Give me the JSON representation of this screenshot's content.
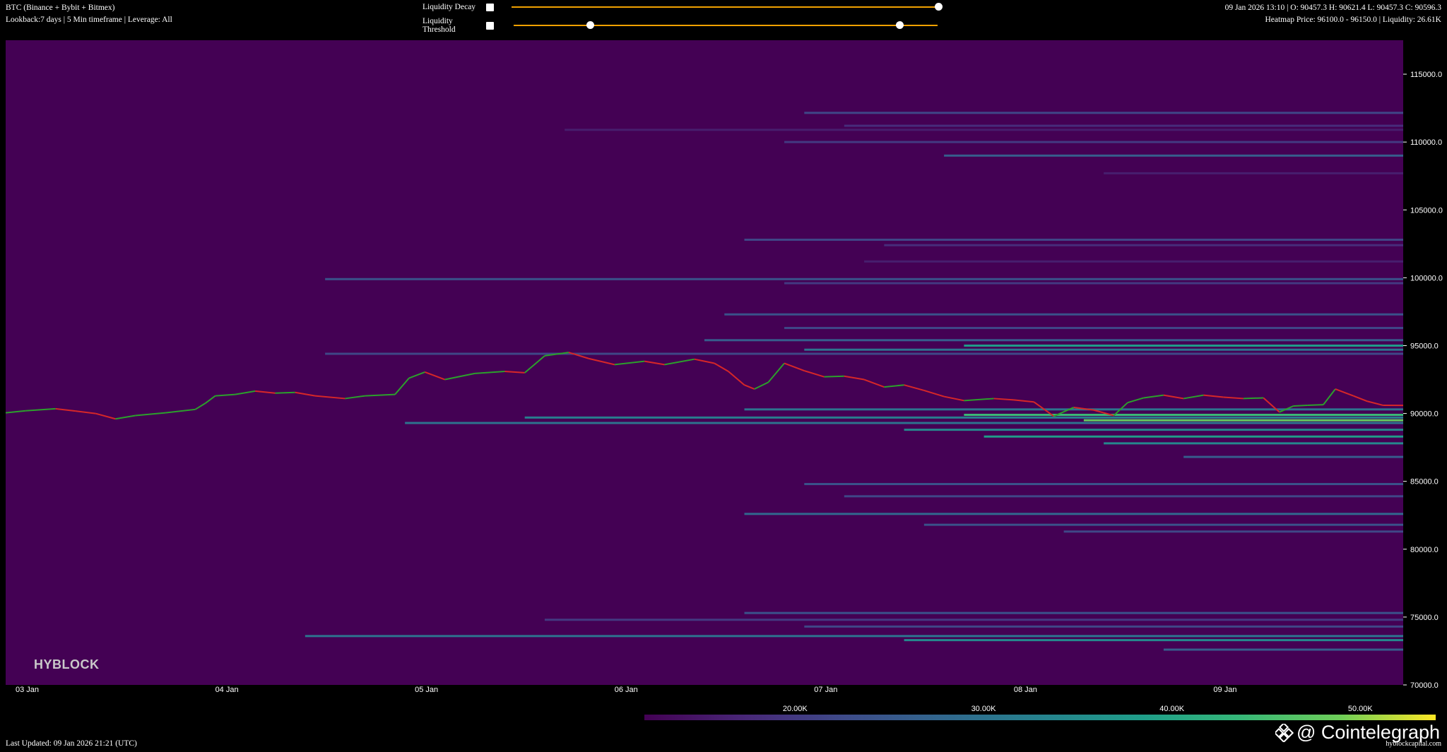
{
  "header": {
    "title": "BTC (Binance + Bybit + Bitmex)",
    "subtitle": "Lookback:7 days | 5 Min timeframe | Leverage: All",
    "ohlc": "09 Jan 2026 13:10 | O: 90457.3 H: 90621.4 L: 90457.3 C: 90596.3",
    "heatmap_info": "Heatmap Price: 96100.0 - 96150.0 | Liquidity: 26.61K"
  },
  "controls": {
    "decay_label": "Liquidity Decay",
    "threshold_label": "Liquidity Threshold",
    "decay_value": 1.0,
    "threshold_range": [
      0.18,
      0.91
    ]
  },
  "footer": {
    "last_updated": "Last Updated: 09 Jan 2026 21:21 (UTC)",
    "site": "hyblockcapital.com",
    "watermark": "@ Cointelegraph",
    "logo": "HYBLOCK"
  },
  "colors": {
    "background": "#440154",
    "up": "#2ca02c",
    "down": "#d62728",
    "accent": "#f0a000"
  },
  "chart_data": {
    "type": "heatmap",
    "title": "",
    "xlabel": "",
    "ylabel": "",
    "ylim": [
      70000,
      117500
    ],
    "y_ticks": [
      "115000.0",
      "110000.0",
      "105000.0",
      "100000.0",
      "95000.0",
      "90000.0",
      "85000.0",
      "80000.0",
      "75000.0",
      "70000.0"
    ],
    "x_ticks": [
      "03 Jan",
      "04 Jan",
      "05 Jan",
      "06 Jan",
      "07 Jan",
      "08 Jan",
      "09 Jan"
    ],
    "xlim_days": [
      3.0,
      10.0
    ],
    "colorbar_ticks": [
      "20.00K",
      "30.00K",
      "40.00K",
      "50.00K"
    ],
    "colorbar_range": [
      12000,
      54000
    ],
    "price_series": [
      [
        3.0,
        90050
      ],
      [
        3.1,
        90200
      ],
      [
        3.25,
        90350
      ],
      [
        3.35,
        90180
      ],
      [
        3.45,
        90000
      ],
      [
        3.55,
        89600
      ],
      [
        3.65,
        89850
      ],
      [
        3.8,
        90050
      ],
      [
        3.95,
        90300
      ],
      [
        4.0,
        90750
      ],
      [
        4.05,
        91300
      ],
      [
        4.15,
        91400
      ],
      [
        4.25,
        91650
      ],
      [
        4.35,
        91500
      ],
      [
        4.45,
        91550
      ],
      [
        4.55,
        91300
      ],
      [
        4.7,
        91100
      ],
      [
        4.8,
        91300
      ],
      [
        4.95,
        91400
      ],
      [
        5.02,
        92600
      ],
      [
        5.1,
        93050
      ],
      [
        5.2,
        92500
      ],
      [
        5.35,
        92950
      ],
      [
        5.5,
        93100
      ],
      [
        5.6,
        93000
      ],
      [
        5.7,
        94250
      ],
      [
        5.82,
        94500
      ],
      [
        5.92,
        94050
      ],
      [
        6.05,
        93600
      ],
      [
        6.2,
        93850
      ],
      [
        6.3,
        93600
      ],
      [
        6.45,
        94000
      ],
      [
        6.55,
        93700
      ],
      [
        6.62,
        93100
      ],
      [
        6.7,
        92100
      ],
      [
        6.75,
        91800
      ],
      [
        6.82,
        92300
      ],
      [
        6.9,
        93700
      ],
      [
        7.0,
        93150
      ],
      [
        7.1,
        92700
      ],
      [
        7.2,
        92750
      ],
      [
        7.3,
        92500
      ],
      [
        7.4,
        91950
      ],
      [
        7.5,
        92100
      ],
      [
        7.6,
        91700
      ],
      [
        7.7,
        91250
      ],
      [
        7.8,
        90950
      ],
      [
        7.95,
        91100
      ],
      [
        8.05,
        91000
      ],
      [
        8.15,
        90850
      ],
      [
        8.25,
        89800
      ],
      [
        8.35,
        90450
      ],
      [
        8.45,
        90250
      ],
      [
        8.55,
        89850
      ],
      [
        8.62,
        90800
      ],
      [
        8.7,
        91150
      ],
      [
        8.8,
        91350
      ],
      [
        8.9,
        91100
      ],
      [
        9.0,
        91350
      ],
      [
        9.1,
        91200
      ],
      [
        9.2,
        91100
      ],
      [
        9.3,
        91150
      ],
      [
        9.38,
        90100
      ],
      [
        9.45,
        90550
      ],
      [
        9.52,
        90600
      ],
      [
        9.6,
        90650
      ],
      [
        9.66,
        91800
      ],
      [
        9.75,
        91300
      ],
      [
        9.82,
        90900
      ],
      [
        9.9,
        90600
      ],
      [
        10.0,
        90596
      ]
    ],
    "liquidity_bands": [
      {
        "price": 112150,
        "start_day": 7.0,
        "value": 22000
      },
      {
        "price": 111200,
        "start_day": 7.2,
        "value": 18000
      },
      {
        "price": 110900,
        "start_day": 5.8,
        "value": 16000
      },
      {
        "price": 110000,
        "start_day": 6.9,
        "value": 20000
      },
      {
        "price": 109000,
        "start_day": 7.7,
        "value": 26000
      },
      {
        "price": 107700,
        "start_day": 8.5,
        "value": 16000
      },
      {
        "price": 102800,
        "start_day": 6.7,
        "value": 22000
      },
      {
        "price": 102400,
        "start_day": 7.4,
        "value": 18000
      },
      {
        "price": 101200,
        "start_day": 7.3,
        "value": 16000
      },
      {
        "price": 99900,
        "start_day": 4.6,
        "value": 24000
      },
      {
        "price": 99600,
        "start_day": 6.9,
        "value": 20000
      },
      {
        "price": 97300,
        "start_day": 6.6,
        "value": 24000
      },
      {
        "price": 96300,
        "start_day": 6.9,
        "value": 22000
      },
      {
        "price": 95400,
        "start_day": 6.5,
        "value": 26000
      },
      {
        "price": 95000,
        "start_day": 7.8,
        "value": 38000
      },
      {
        "price": 94700,
        "start_day": 7.0,
        "value": 30000
      },
      {
        "price": 94400,
        "start_day": 4.6,
        "value": 22000
      },
      {
        "price": 90300,
        "start_day": 6.7,
        "value": 30000
      },
      {
        "price": 89900,
        "start_day": 7.8,
        "value": 44000
      },
      {
        "price": 89700,
        "start_day": 5.6,
        "value": 32000
      },
      {
        "price": 89500,
        "start_day": 8.4,
        "value": 48000
      },
      {
        "price": 89300,
        "start_day": 5.0,
        "value": 30000
      },
      {
        "price": 88800,
        "start_day": 7.5,
        "value": 34000
      },
      {
        "price": 88300,
        "start_day": 7.9,
        "value": 38000
      },
      {
        "price": 87800,
        "start_day": 8.5,
        "value": 34000
      },
      {
        "price": 86800,
        "start_day": 8.9,
        "value": 26000
      },
      {
        "price": 84800,
        "start_day": 7.0,
        "value": 24000
      },
      {
        "price": 83900,
        "start_day": 7.2,
        "value": 22000
      },
      {
        "price": 82600,
        "start_day": 6.7,
        "value": 28000
      },
      {
        "price": 81800,
        "start_day": 7.6,
        "value": 24000
      },
      {
        "price": 81300,
        "start_day": 8.3,
        "value": 22000
      },
      {
        "price": 75300,
        "start_day": 6.7,
        "value": 24000
      },
      {
        "price": 74800,
        "start_day": 5.7,
        "value": 20000
      },
      {
        "price": 74300,
        "start_day": 7.0,
        "value": 22000
      },
      {
        "price": 73600,
        "start_day": 4.5,
        "value": 30000
      },
      {
        "price": 73300,
        "start_day": 7.5,
        "value": 34000
      },
      {
        "price": 72600,
        "start_day": 8.8,
        "value": 26000
      }
    ]
  }
}
